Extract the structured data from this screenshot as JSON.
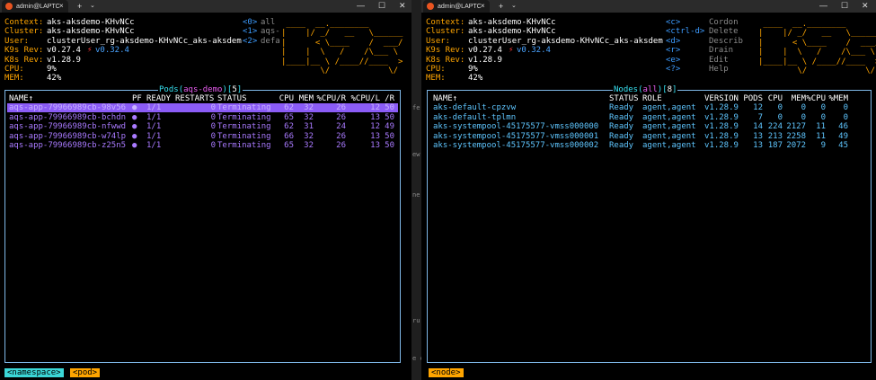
{
  "left": {
    "tab_title": "admin@LAPTC",
    "info": [
      {
        "label": "Context:",
        "value": "aks-aksdemo-KHvNCc"
      },
      {
        "label": "Cluster:",
        "value": "aks-aksdemo-KHvNCc"
      },
      {
        "label": "User:",
        "value": "clusterUser_rg-aksdemo-KHvNCc_aks-aksdem"
      },
      {
        "label": "K9s Rev:",
        "value": "v0.27.4",
        "extra": "v0.32.4"
      },
      {
        "label": "K8s Rev:",
        "value": "v1.28.9"
      },
      {
        "label": "CPU:",
        "value": "9%"
      },
      {
        "label": "MEM:",
        "value": "42%"
      }
    ],
    "hotkeys": [
      {
        "key": "<0>",
        "label": "all"
      },
      {
        "key": "<1>",
        "label": "aqs-"
      },
      {
        "key": "<2>",
        "label": "defa"
      }
    ],
    "panel": {
      "resource": "Pods",
      "scope": "aqs-demo",
      "count": "5"
    },
    "columns": {
      "name": "NAME↑",
      "pf": "PF",
      "ready": "READY",
      "restarts": "RESTARTS",
      "status": "STATUS",
      "cpu": "CPU",
      "mem": "MEM",
      "cpur": "%CPU/R",
      "cpul": "%CPU/L",
      "r": "/R"
    },
    "rows": [
      {
        "name": "aqs-app-79966989cb-98v56",
        "pf": "●",
        "ready": "1/1",
        "restarts": "0",
        "status": "Terminating",
        "cpu": "62",
        "mem": "32",
        "cpur": "26",
        "cpul": "12",
        "r": "50"
      },
      {
        "name": "aqs-app-79966989cb-bchdn",
        "pf": "●",
        "ready": "1/1",
        "restarts": "0",
        "status": "Terminating",
        "cpu": "65",
        "mem": "32",
        "cpur": "26",
        "cpul": "13",
        "r": "50"
      },
      {
        "name": "aqs-app-79966989cb-nfwwd",
        "pf": "●",
        "ready": "1/1",
        "restarts": "0",
        "status": "Terminating",
        "cpu": "62",
        "mem": "31",
        "cpur": "24",
        "cpul": "12",
        "r": "49"
      },
      {
        "name": "aqs-app-79966989cb-w74lp",
        "pf": "●",
        "ready": "1/1",
        "restarts": "0",
        "status": "Terminating",
        "cpu": "66",
        "mem": "32",
        "cpur": "26",
        "cpul": "13",
        "r": "50"
      },
      {
        "name": "aqs-app-79966989cb-z25n5",
        "pf": "●",
        "ready": "1/1",
        "restarts": "0",
        "status": "Terminating",
        "cpu": "65",
        "mem": "32",
        "cpur": "26",
        "cpul": "13",
        "r": "50"
      }
    ],
    "crumbs": [
      "<namespace>",
      "<pod>"
    ]
  },
  "right": {
    "tab_title": "admin@LAPTC",
    "info": [
      {
        "label": "Context:",
        "value": "aks-aksdemo-KHvNCc"
      },
      {
        "label": "Cluster:",
        "value": "aks-aksdemo-KHvNCc"
      },
      {
        "label": "User:",
        "value": "clusterUser_rg-aksdemo-KHvNCc_aks-aksdem"
      },
      {
        "label": "K9s Rev:",
        "value": "v0.27.4",
        "extra": "v0.32.4"
      },
      {
        "label": "K8s Rev:",
        "value": "v1.28.9"
      },
      {
        "label": "CPU:",
        "value": "9%"
      },
      {
        "label": "MEM:",
        "value": "42%"
      }
    ],
    "hotkeys": [
      {
        "key": "<c>",
        "label": "Cordon"
      },
      {
        "key": "<ctrl-d>",
        "label": "Delete"
      },
      {
        "key": "<d>",
        "label": "Describ"
      },
      {
        "key": "<r>",
        "label": "Drain"
      },
      {
        "key": "<e>",
        "label": "Edit"
      },
      {
        "key": "<?>",
        "label": "Help"
      }
    ],
    "panel": {
      "resource": "Nodes",
      "scope": "all",
      "count": "8"
    },
    "columns": {
      "name": "NAME↑",
      "status": "STATUS",
      "role": "ROLE",
      "version": "VERSION",
      "pods": "PODS",
      "cpu": "CPU",
      "mem": "MEM",
      "pcpu": "%CPU",
      "pmem": "%MEM"
    },
    "rows": [
      {
        "name": "aks-default-cpzvw",
        "status": "Ready",
        "role": "agent,agent",
        "version": "v1.28.9",
        "pods": "12",
        "cpu": "0",
        "mem": "0",
        "pcpu": "0",
        "pmem": "0"
      },
      {
        "name": "aks-default-tplmn",
        "status": "Ready",
        "role": "agent,agent",
        "version": "v1.28.9",
        "pods": "7",
        "cpu": "0",
        "mem": "0",
        "pcpu": "0",
        "pmem": "0"
      },
      {
        "name": "aks-systempool-45175577-vmss000000",
        "status": "Ready",
        "role": "agent,agent",
        "version": "v1.28.9",
        "pods": "14",
        "cpu": "224",
        "mem": "2127",
        "pcpu": "11",
        "pmem": "46"
      },
      {
        "name": "aks-systempool-45175577-vmss000001",
        "status": "Ready",
        "role": "agent,agent",
        "version": "v1.28.9",
        "pods": "13",
        "cpu": "213",
        "mem": "2258",
        "pcpu": "11",
        "pmem": "49"
      },
      {
        "name": "aks-systempool-45175577-vmss000002",
        "status": "Ready",
        "role": "agent,agent",
        "version": "v1.28.9",
        "pods": "13",
        "cpu": "187",
        "mem": "2072",
        "pcpu": "9",
        "pmem": "45"
      }
    ],
    "crumbs": [
      "<node>"
    ]
  },
  "window_controls": {
    "min": "—",
    "max": "☐",
    "close": "✕"
  },
  "tab_close": "×",
  "tab_new": "+",
  "tab_menu": "⌄",
  "gap_fragments": [
    "fe",
    "ew",
    "ne",
    "ru",
    "e c"
  ],
  "logo": [
    " ____  __.________       ",
    "|    |/ _/   __   \\______",
    "|      < \\____    /  ___/",
    "|    |  \\   /    /\\___ \\ ",
    "|____|__ \\ /____//____  >",
    "        \\/            \\/ "
  ]
}
